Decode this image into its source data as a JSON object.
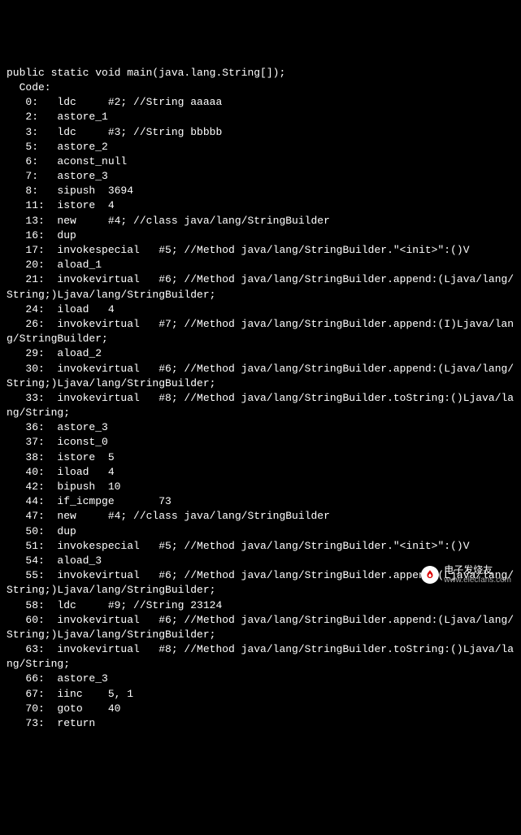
{
  "signature": "public static void main(java.lang.String[]);",
  "code_label": "  Code:",
  "lines": [
    "   0:   ldc     #2; //String aaaaa",
    "   2:   astore_1",
    "   3:   ldc     #3; //String bbbbb",
    "   5:   astore_2",
    "   6:   aconst_null",
    "   7:   astore_3",
    "   8:   sipush  3694",
    "   11:  istore  4",
    "   13:  new     #4; //class java/lang/StringBuilder",
    "   16:  dup",
    "   17:  invokespecial   #5; //Method java/lang/StringBuilder.\"<init>\":()V",
    "   20:  aload_1",
    "   21:  invokevirtual   #6; //Method java/lang/StringBuilder.append:(Ljava/lang/\nString;)Ljava/lang/StringBuilder;",
    "   24:  iload   4",
    "   26:  invokevirtual   #7; //Method java/lang/StringBuilder.append:(I)Ljava/lan\ng/StringBuilder;",
    "   29:  aload_2",
    "   30:  invokevirtual   #6; //Method java/lang/StringBuilder.append:(Ljava/lang/\nString;)Ljava/lang/StringBuilder;",
    "   33:  invokevirtual   #8; //Method java/lang/StringBuilder.toString:()Ljava/la\nng/String;",
    "   36:  astore_3",
    "   37:  iconst_0",
    "   38:  istore  5",
    "   40:  iload   4",
    "   42:  bipush  10",
    "   44:  if_icmpge       73",
    "   47:  new     #4; //class java/lang/StringBuilder",
    "   50:  dup",
    "   51:  invokespecial   #5; //Method java/lang/StringBuilder.\"<init>\":()V",
    "   54:  aload_3",
    "   55:  invokevirtual   #6; //Method java/lang/StringBuilder.append:(Ljava/lang/\nString;)Ljava/lang/StringBuilder;",
    "   58:  ldc     #9; //String 23124",
    "   60:  invokevirtual   #6; //Method java/lang/StringBuilder.append:(Ljava/lang/\nString;)Ljava/lang/StringBuilder;",
    "   63:  invokevirtual   #8; //Method java/lang/StringBuilder.toString:()Ljava/la\nng/String;",
    "   66:  astore_3",
    "   67:  iinc    5, 1",
    "   70:  goto    40",
    "   73:  return"
  ],
  "watermark": {
    "cn": "电子发烧友",
    "url": "www.elecfans.com"
  }
}
